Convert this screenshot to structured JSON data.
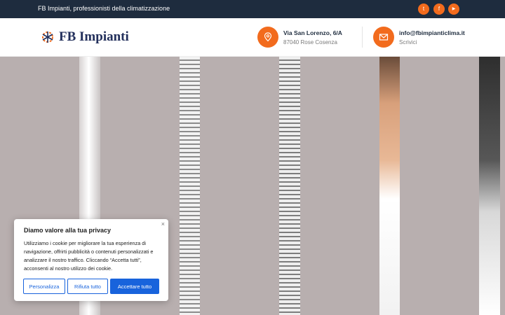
{
  "topbar": {
    "tagline": "FB Impianti, professionisti della climatizzazione",
    "social": [
      {
        "icon": "twitter-icon",
        "glyph": "t"
      },
      {
        "icon": "facebook-icon",
        "glyph": "f"
      },
      {
        "icon": "youtube-icon",
        "glyph": "▶"
      }
    ]
  },
  "header": {
    "logo_text": "FB Impianti",
    "address": {
      "title": "Via San Lorenzo, 6/A",
      "sub": "87040 Rose Cosenza",
      "icon": "map-pin-icon"
    },
    "contact": {
      "title": "info@fbimpianticlima.it",
      "sub": "Scrivici",
      "icon": "envelope-icon"
    }
  },
  "cookie": {
    "title": "Diamo valore alla tua privacy",
    "body": "Utilizziamo i cookie per migliorare la tua esperienza di navigazione, offrirti pubblicità o contenuti personalizzati e analizzare il nostro traffico. Cliccando “Accetta tutti”, acconsenti al nostro utilizzo dei cookie.",
    "close": "×",
    "buttons": {
      "customize": "Personalizza",
      "reject": "Rifiuta tutto",
      "accept": "Accettare tutto"
    }
  },
  "colors": {
    "accent": "#f26b1d",
    "topbar": "#1e2c3e",
    "brand": "#23305c",
    "cookie_button": "#1863dc"
  }
}
